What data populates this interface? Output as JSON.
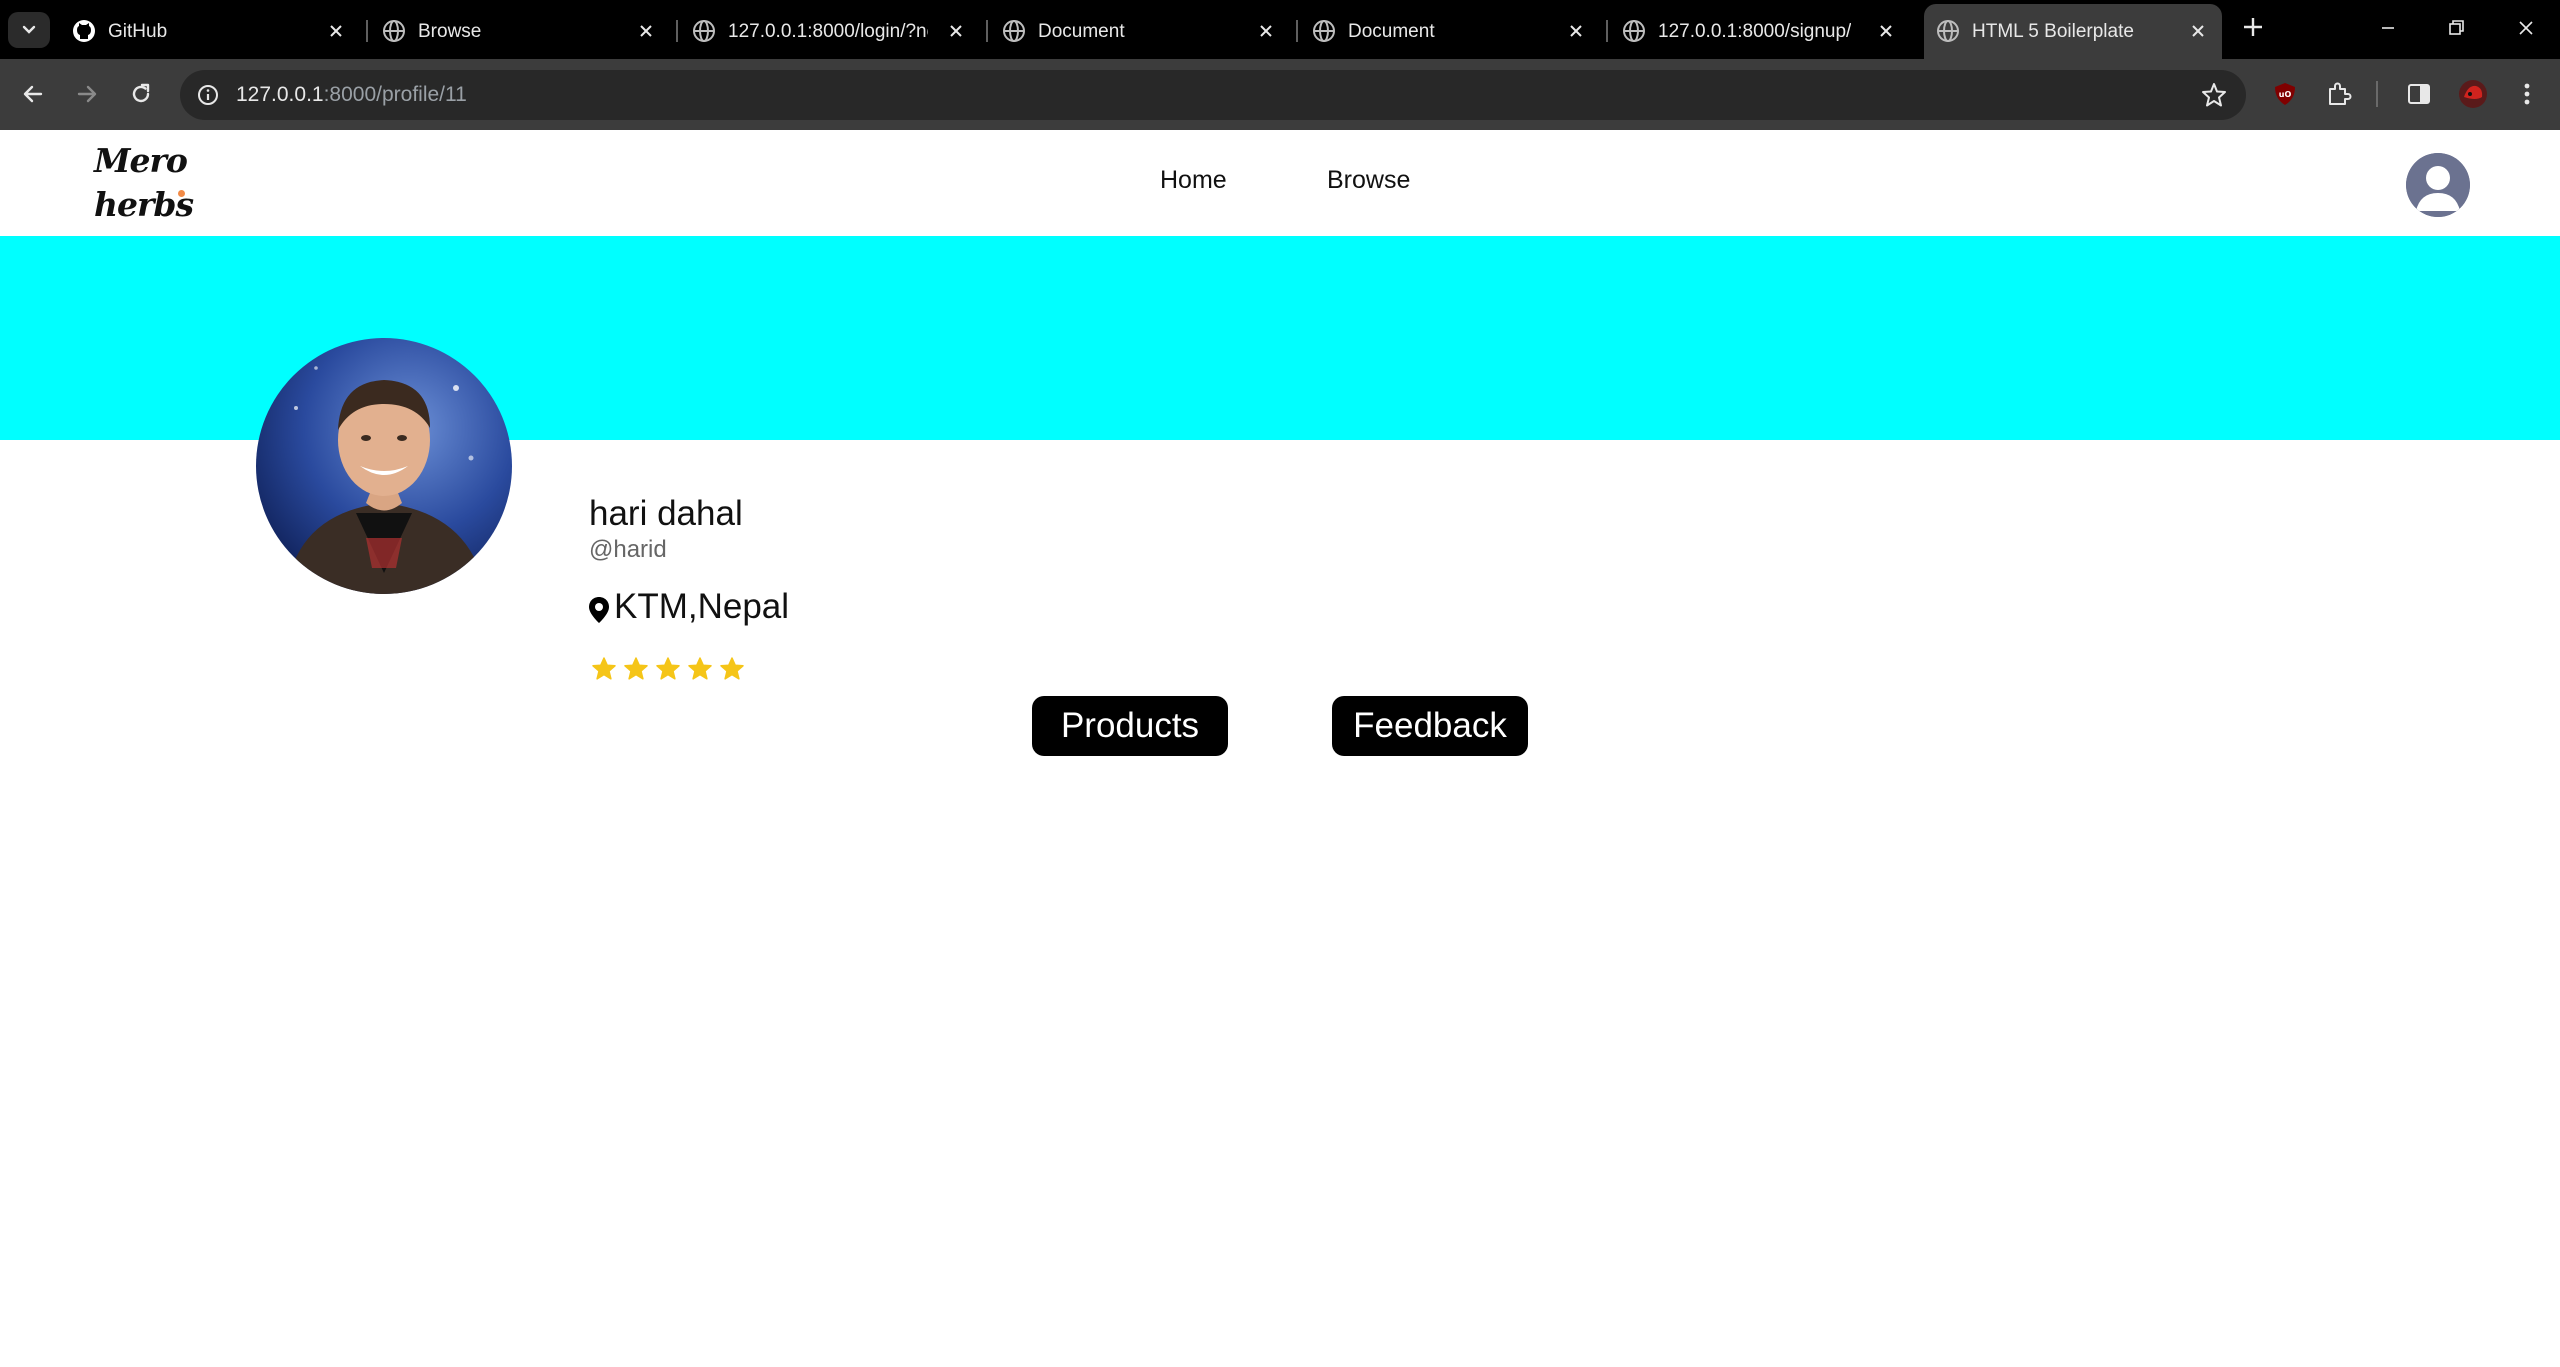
{
  "browser": {
    "tabs": [
      {
        "title": "GitHub",
        "favicon": "github-icon",
        "active": false
      },
      {
        "title": "Browse",
        "favicon": "globe-icon",
        "active": false
      },
      {
        "title": "127.0.0.1:8000/login/?nex",
        "favicon": "globe-icon",
        "active": false
      },
      {
        "title": "Document",
        "favicon": "globe-icon",
        "active": false
      },
      {
        "title": "Document",
        "favicon": "globe-icon",
        "active": false
      },
      {
        "title": "127.0.0.1:8000/signup/",
        "favicon": "globe-icon",
        "active": false
      },
      {
        "title": "HTML 5 Boilerplate",
        "favicon": "globe-icon",
        "active": true
      }
    ],
    "url_host": "127.0.0.1",
    "url_rest": ":8000/profile/11"
  },
  "site": {
    "logo_line1": "Mero",
    "logo_line2": "herbs",
    "nav": {
      "home": "Home",
      "browse": "Browse"
    }
  },
  "profile": {
    "name": "hari dahal",
    "handle": "@harid",
    "location": "KTM,Nepal",
    "rating": 5,
    "buttons": {
      "products": "Products",
      "feedback": "Feedback"
    }
  },
  "colors": {
    "cover": "#00ffff",
    "star": "#f5c518",
    "button_bg": "#000000",
    "logo_dot": "#f28b47"
  }
}
